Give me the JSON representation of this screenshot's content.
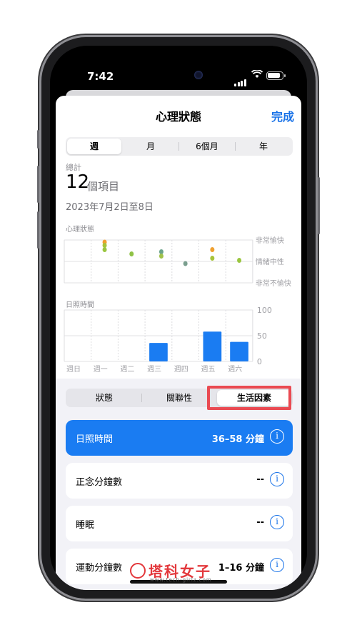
{
  "status_bar": {
    "time": "7:42"
  },
  "header": {
    "title": "心理狀態",
    "done_label": "完成"
  },
  "period_tabs": [
    {
      "label": "週",
      "selected": true
    },
    {
      "label": "月",
      "selected": false
    },
    {
      "label": "6個月",
      "selected": false
    },
    {
      "label": "年",
      "selected": false
    }
  ],
  "summary": {
    "total_label": "總計",
    "count": "12",
    "count_unit": "個項目",
    "date_range": "2023年7月2日至8日"
  },
  "chart_data": [
    {
      "type": "scatter",
      "title": "心理狀態",
      "y_labels": [
        "非常愉快",
        "情緒中性",
        "非常不愉快"
      ],
      "categories": [
        "週日",
        "週一",
        "週二",
        "週三",
        "週四",
        "週五",
        "週六"
      ],
      "series": [
        {
          "values": [
            [],
            [
              0.9,
              0.75,
              0.55
            ],
            [
              0.35
            ],
            [
              0.45,
              0.25
            ],
            [
              -0.1
            ],
            [
              0.55,
              0.15
            ],
            [
              0.05
            ]
          ]
        }
      ],
      "point_colors": [
        "#f0a030",
        "#a8c43a",
        "#9ac640",
        "#8fc246",
        "#6aa48a",
        "#a0c24a",
        "#7a9e8e"
      ]
    },
    {
      "type": "bar",
      "title": "日照時間",
      "categories": [
        "週日",
        "週一",
        "週二",
        "週三",
        "週四",
        "週五",
        "週六"
      ],
      "values": [
        0,
        0,
        0,
        36,
        0,
        58,
        38
      ],
      "ylim": [
        0,
        100
      ],
      "y_ticks": [
        "100",
        "50",
        "0"
      ],
      "bar_color": "#1a7cf2"
    }
  ],
  "factor_tabs": [
    {
      "label": "狀態",
      "selected": false
    },
    {
      "label": "關聯性",
      "selected": false
    },
    {
      "label": "生活因素",
      "selected": true
    }
  ],
  "factors": [
    {
      "name": "日照時間",
      "value": "36–58 分鐘",
      "active": true
    },
    {
      "name": "正念分鐘數",
      "value": "--",
      "active": false
    },
    {
      "name": "睡眠",
      "value": "--",
      "active": false
    },
    {
      "name": "運動分鐘數",
      "value": "1–16 分鐘",
      "active": false
    }
  ],
  "watermark": {
    "title": "塔科女子",
    "url": "www.tech-girlz.com"
  },
  "colors": {
    "accent": "#1a73e8",
    "highlight_box": "#ea4a52"
  }
}
